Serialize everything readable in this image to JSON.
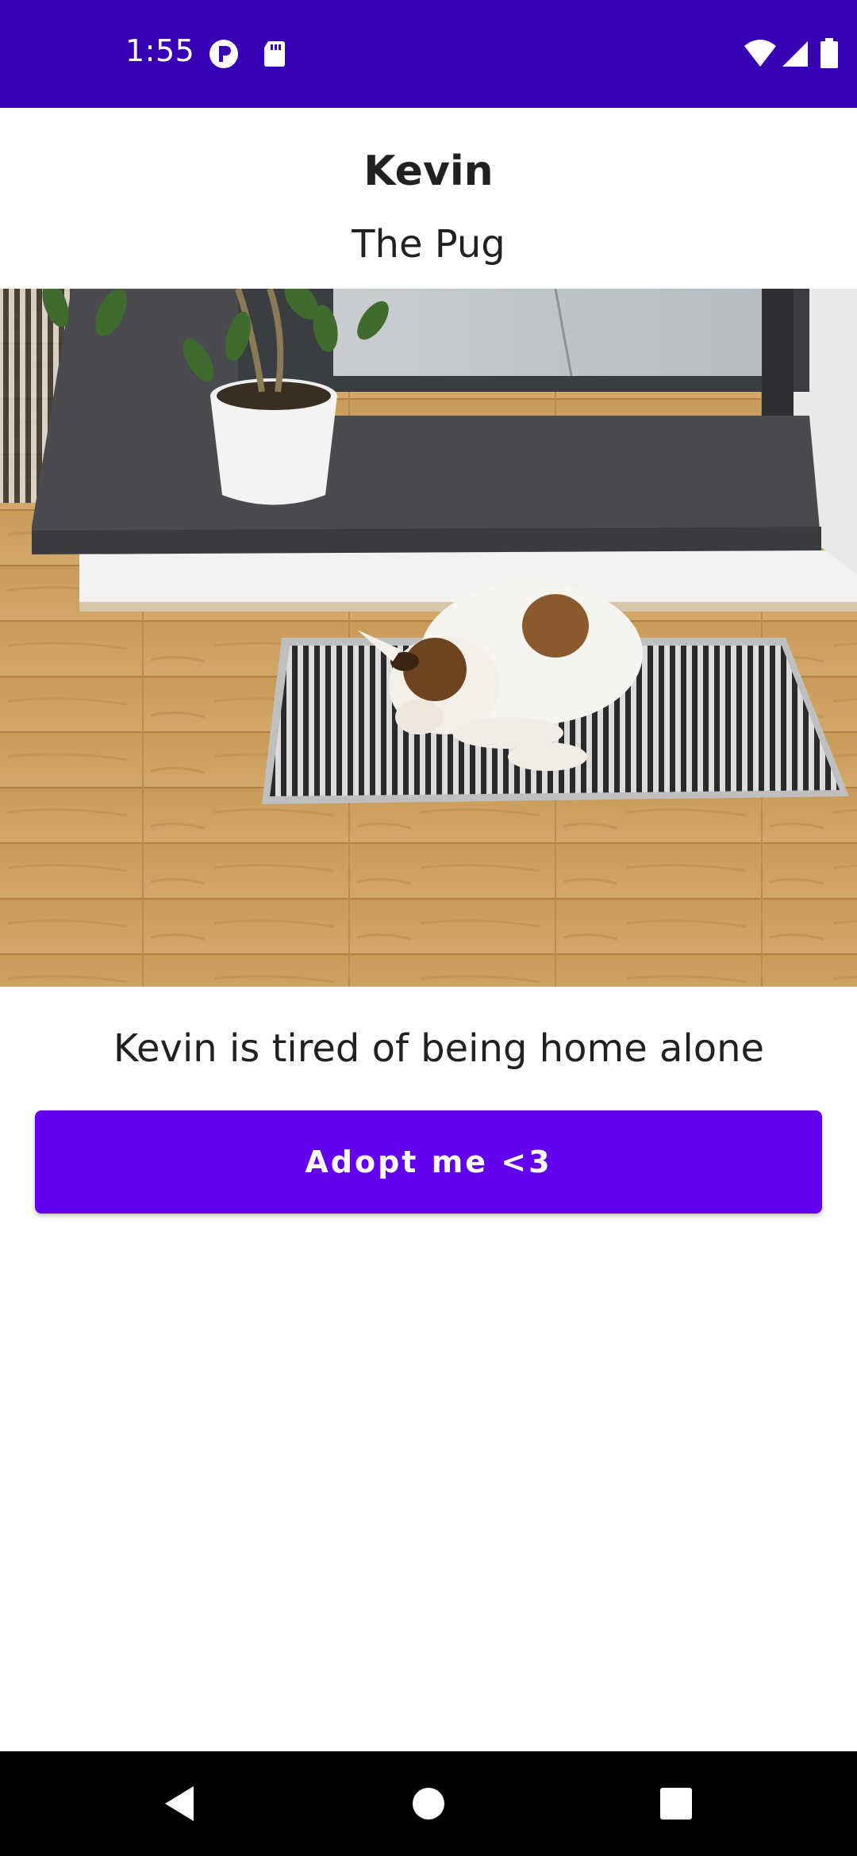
{
  "status_bar": {
    "time": "1:55",
    "background_color": "#3700b3",
    "icons": [
      "notification-app-icon",
      "sd-card-icon",
      "wifi-icon",
      "cell-signal-icon",
      "battery-icon"
    ]
  },
  "pet": {
    "name": "Kevin",
    "breed": "The Pug",
    "description": "Kevin is tired of being home alone"
  },
  "actions": {
    "adopt_label": "Adopt me <3",
    "accent_color": "#6200ee"
  },
  "nav_bar": {
    "buttons": [
      "back-icon",
      "home-icon",
      "recents-icon"
    ]
  }
}
